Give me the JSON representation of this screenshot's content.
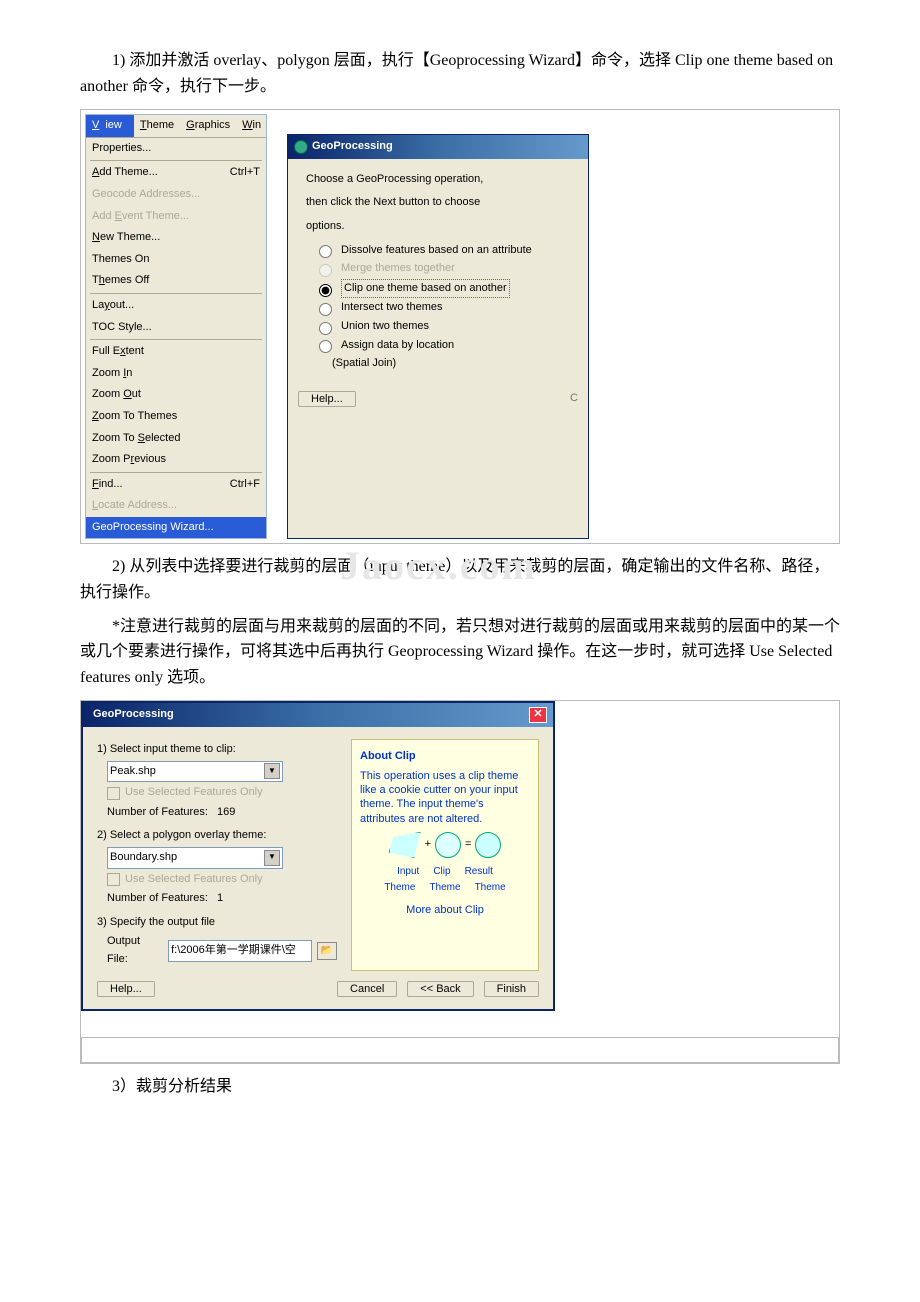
{
  "para1": "1) 添加并激活 overlay、polygon 层面，执行【Geoprocessing Wizard】命令，选择 Clip one theme based on another 命令，执行下一步。",
  "para2": "2) 从列表中选择要进行裁剪的层面（input theme）以及用来裁剪的层面，确定输出的文件名称、路径，执行操作。",
  "para3_note": "*注意进行裁剪的层面与用来裁剪的层面的不同，若只想对进行裁剪的层面或用来裁剪的层面中的某一个或几个要素进行操作，可将其选中后再执行 Geoprocessing Wizard 操作。在这一步时，就可选择 Use Selected features only 选项。",
  "para4": "3）裁剪分析结果",
  "watermark": "Jaocx.com",
  "menu": {
    "bar": {
      "view": "View",
      "theme": "Theme",
      "graphics": "Graphics",
      "win": "Win"
    },
    "items": {
      "properties": "Properties...",
      "add_theme": "Add Theme...",
      "add_theme_sc": "Ctrl+T",
      "geocode": "Geocode Addresses...",
      "add_event": "Add Event Theme...",
      "new_theme": "New Theme...",
      "themes_on": "Themes On",
      "themes_off": "Themes Off",
      "layout": "Layout...",
      "toc_style": "TOC Style...",
      "full_extent": "Full Extent",
      "zoom_in": "Zoom In",
      "zoom_out": "Zoom Out",
      "zoom_themes": "Zoom To Themes",
      "zoom_selected": "Zoom To Selected",
      "zoom_prev": "Zoom Previous",
      "find": "Find...",
      "find_sc": "Ctrl+F",
      "locate": "Locate Address...",
      "geowiz": "GeoProcessing Wizard..."
    }
  },
  "dlg1": {
    "title": "GeoProcessing",
    "instr1": "Choose a GeoProcessing operation,",
    "instr2": "then click the Next button to choose",
    "instr3": "options.",
    "opt_dissolve": "Dissolve features based on an attribute",
    "opt_merge": "Merge themes together",
    "opt_clip": "Clip one theme based on another",
    "opt_intersect": "Intersect two themes",
    "opt_union": "Union two themes",
    "opt_assign": "Assign data by location",
    "opt_spatial": "(Spatial Join)",
    "help": "Help..."
  },
  "dlg2": {
    "title": "GeoProcessing",
    "s1": "1) Select input theme to clip:",
    "s1_val": "Peak.shp",
    "use_sel": "Use Selected Features Only",
    "nof": "Number of Features:",
    "nof1": "169",
    "s2": "2) Select a polygon overlay theme:",
    "s2_val": "Boundary.shp",
    "nof2": "1",
    "s3": "3) Specify the output file",
    "out_label": "Output File:",
    "out_val": "f:\\2006年第一学期课件\\空",
    "help": "Help...",
    "cancel": "Cancel",
    "back": "<< Back",
    "finish": "Finish",
    "about": "About Clip",
    "desc": "This operation uses a clip theme like a cookie cutter on your input theme. The input theme's attributes are not altered.",
    "lbl_input": "Input",
    "lbl_theme": "Theme",
    "lbl_clip": "Clip",
    "lbl_result": "Result",
    "plus": "+",
    "eq": "=",
    "more": "More about Clip"
  }
}
